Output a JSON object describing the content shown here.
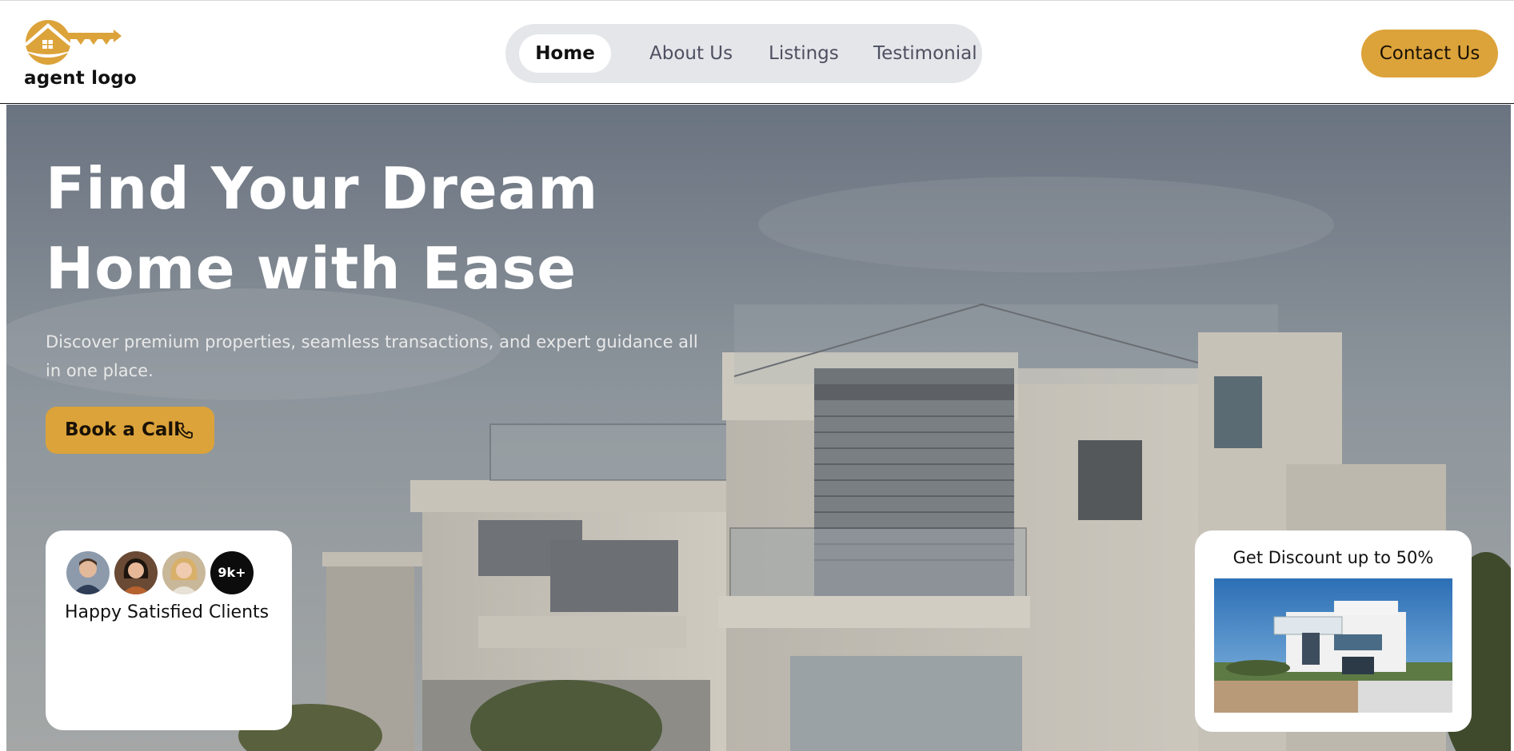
{
  "header": {
    "logo_text": "agent logo",
    "nav": [
      {
        "label": "Home",
        "active": true
      },
      {
        "label": "About Us",
        "active": false
      },
      {
        "label": "Listings",
        "active": false
      },
      {
        "label": "Testimonial",
        "active": false
      }
    ],
    "contact_label": "Contact Us"
  },
  "hero": {
    "title": "Find Your Dream Home with Ease",
    "subtitle": "Discover premium properties, seamless transactions, and expert guidance all in one place.",
    "cta_label": "Book a Call",
    "cta_icon": "phone-icon"
  },
  "clients_card": {
    "badge": "9k+",
    "label": "Happy Satisfied Clients"
  },
  "discount_card": {
    "title": "Get Discount up to 50%"
  },
  "colors": {
    "accent": "#dca33a",
    "nav_bg": "#e5e6ea",
    "text_dark": "#111111"
  }
}
